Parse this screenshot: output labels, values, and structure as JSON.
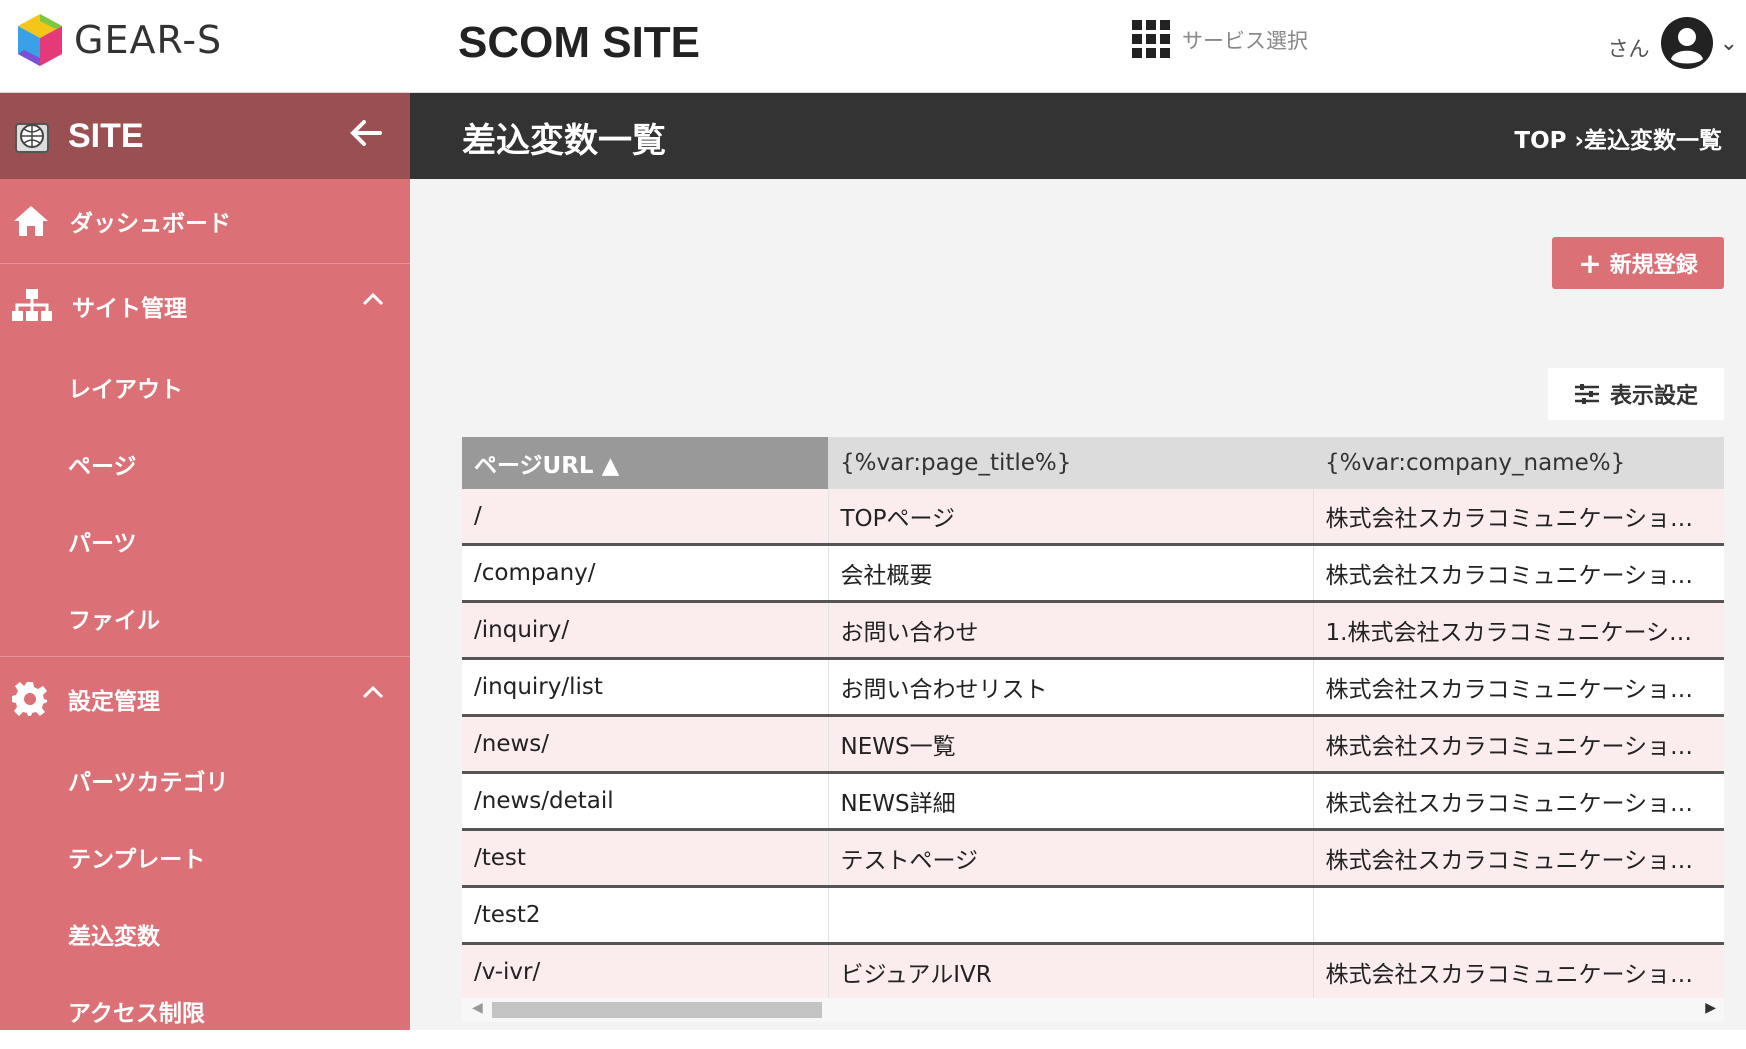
{
  "header": {
    "logo_text": "GEAR-S",
    "site_title": "SCOM SITE",
    "service_label": "サービス選択",
    "user_suffix": "さん"
  },
  "sidebar": {
    "title": "SITE",
    "items": [
      {
        "label": "ダッシュボード",
        "icon": "home-icon"
      },
      {
        "label": "サイト管理",
        "icon": "sitemap-icon",
        "expanded": true,
        "children": [
          "レイアウト",
          "ページ",
          "パーツ",
          "ファイル"
        ]
      },
      {
        "label": "設定管理",
        "icon": "gear-icon",
        "expanded": true,
        "children": [
          "パーツカテゴリ",
          "テンプレート",
          "差込変数",
          "アクセス制限"
        ]
      }
    ]
  },
  "page": {
    "title": "差込変数一覧",
    "breadcrumb": "TOP ›差込変数一覧"
  },
  "toolbar": {
    "new_label": "新規登録",
    "display_settings_label": "表示設定"
  },
  "table": {
    "columns": [
      "ページURL ▲",
      "{%var:page_title%}",
      "{%var:company_name%}"
    ],
    "rows": [
      [
        "/",
        "TOPページ",
        "株式会社スカラコミュニケーショ…"
      ],
      [
        "/company/",
        "会社概要",
        "株式会社スカラコミュニケーショ…"
      ],
      [
        "/inquiry/",
        "お問い合わせ",
        "1.株式会社スカラコミュニケーショ…"
      ],
      [
        "/inquiry/list",
        "お問い合わせリスト",
        "株式会社スカラコミュニケーショ…"
      ],
      [
        "/news/",
        "NEWS一覧",
        "株式会社スカラコミュニケーショ…"
      ],
      [
        "/news/detail",
        "NEWS詳細",
        "株式会社スカラコミュニケーショ…"
      ],
      [
        "/test",
        "テストページ",
        "株式会社スカラコミュニケーショ…"
      ],
      [
        "/test2",
        "",
        ""
      ],
      [
        "/v-ivr/",
        "ビジュアルIVR",
        "株式会社スカラコミュニケーショ…"
      ]
    ]
  },
  "colors": {
    "sidebar": "#db7176",
    "sidebar_header": "#9a4f52",
    "page_header": "#333333",
    "accent_button": "#db7176",
    "row_tint": "#fbeded"
  }
}
